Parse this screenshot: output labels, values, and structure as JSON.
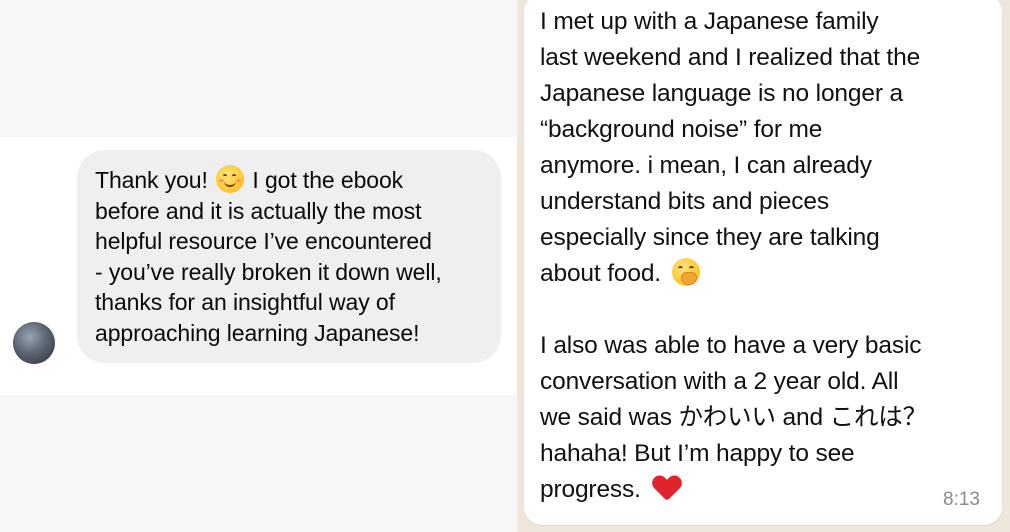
{
  "instagram_message": {
    "text_part1": "Thank you!",
    "emoji": "smiling-face-emoji",
    "text_part2": "I got the ebook\nbefore and it is actually the most\nhelpful resource I’ve encountered\n- you’ve really broken it down well,\nthanks for an insightful way of\napproaching learning Japanese!"
  },
  "whatsapp_message": {
    "paragraph1": "I met up with a Japanese family\nlast weekend and I realized that the\nJapanese language is no longer a\n“background noise” for me\nanymore. i mean, I can already\nunderstand bits and pieces\nespecially since they are talking\nabout food.",
    "paragraph1_emoji": "hand-over-mouth-emoji",
    "paragraph2": "I also was able to have a very basic\nconversation with a 2 year old. All\nwe said was かわいい and これは？\nhahaha! But I’m happy to see\nprogress.",
    "paragraph2_emoji": "red-heart-emoji",
    "time": "8:13"
  },
  "colors": {
    "instagram_bubble": "#efefef",
    "whatsapp_bubble": "#ffffff",
    "whatsapp_background": "#efe6dc",
    "heart": "#e0242e"
  }
}
